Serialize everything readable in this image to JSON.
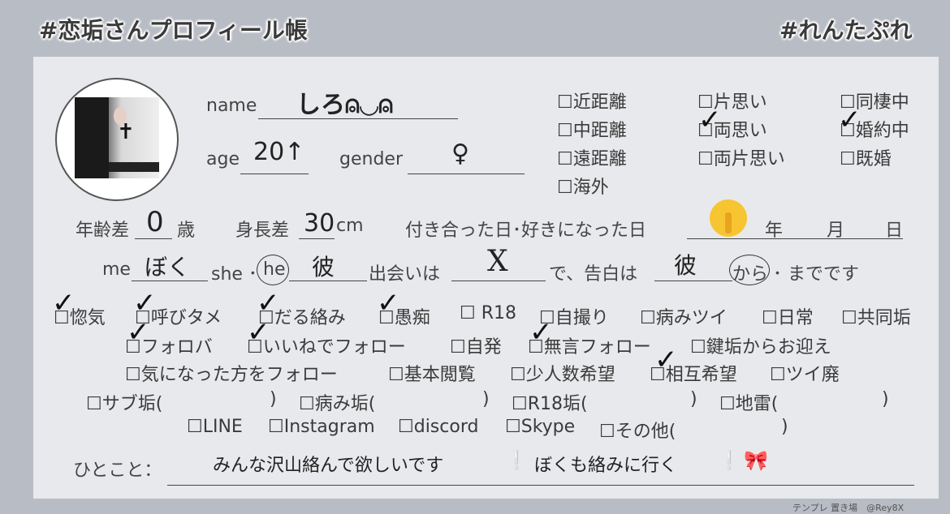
{
  "header": {
    "left_tag": "#恋垢さんプロフィール帳",
    "right_tag": "#れんたぷれ"
  },
  "profile": {
    "name_label": "name",
    "name_value": "しろ⍝◡⍝",
    "age_label": "age",
    "age_value": "20↑",
    "gender_label": "gender",
    "gender_value": "♀"
  },
  "distance": [
    "☐近距離",
    "☐中距離",
    "☐遠距離",
    "☐海外"
  ],
  "love_state": [
    "☐片思い",
    "☐両思い",
    "☐両片思い"
  ],
  "relationship": [
    "☐同棲中",
    "☐婚約中",
    "☐既婚"
  ],
  "details": {
    "age_gap_label": "年齢差",
    "age_gap_value": "0",
    "age_gap_unit": "歳",
    "height_gap_label": "身長差",
    "height_gap_value": "30",
    "height_gap_unit": "cm",
    "date_label": "付き合った日･好きになった日",
    "date_value_icon": "shushing-face-emoji",
    "year_label": "年",
    "month_label": "月",
    "day_label": "日"
  },
  "sentence": {
    "me_label": "me",
    "me_value": "ぼく",
    "she_label": "she ･",
    "he_label": "he",
    "partner_value": "彼",
    "met_label": "出会いは",
    "met_value": "X",
    "confess_label": "で、告白は",
    "confess_value": "彼",
    "kara_label": "から",
    "made_label": "･ までです"
  },
  "options": {
    "row1": [
      "☐惚気",
      "☐呼びタメ",
      "☐だる絡み",
      "☐愚痴",
      "☐ R18",
      "☐自撮り",
      "☐病みツイ",
      "☐日常",
      "☐共同垢"
    ],
    "row2": [
      "☐フォロバ",
      "☐いいねでフォロー",
      "☐自発",
      "☐無言フォロー",
      "☐鍵垢からお迎え"
    ],
    "row3": [
      "☐気になった方をフォロー",
      "☐基本閲覧",
      "☐少人数希望",
      "☐相互希望",
      "☐ツイ廃"
    ],
    "row4": [
      "☐サブ垢(",
      ")",
      "☐病み垢(",
      ")",
      "☐R18垢(",
      ")",
      "☐地雷(",
      ")"
    ],
    "row5": [
      "☐LINE",
      "☐Instagram",
      "☐discord",
      "☐Skype",
      "☐その他(",
      ")"
    ]
  },
  "comment": {
    "label": "ひとこと：",
    "text_a": "みんな沢山絡んで欲しいです",
    "emoji_a": "❕",
    "text_b": "ぼくも絡みに行く",
    "emoji_b": "❕",
    "emoji_c": "🎀"
  },
  "checked": [
    "☐両思い",
    "☐婚約中",
    "☐惚気",
    "☐呼びタメ",
    "☐だる絡み",
    "☐愚痴",
    "☐フォロバ",
    "☐いいねでフォロー",
    "☐無言フォロー",
    "☐相互希望"
  ],
  "check_mark": "✓",
  "credit": "テンプレ 置き場　@Rey8X"
}
